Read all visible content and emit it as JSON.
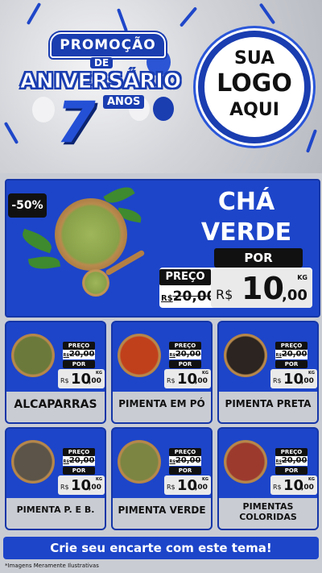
{
  "header": {
    "promo_top": "PROMOÇÃO",
    "promo_de": "DE",
    "promo_main": "ANIVERSÁRIO",
    "promo_number": "7",
    "promo_anos": "ANOS",
    "logo_line1": "SUA",
    "logo_line2": "LOGO",
    "logo_line3": "AQUI"
  },
  "featured": {
    "discount": "-50%",
    "title_line1": "CHÁ",
    "title_line2": "VERDE",
    "preco_label": "PREÇO",
    "por_label": "POR",
    "old_currency": "R$",
    "old_price": "20,00",
    "new_currency": "R$",
    "new_int": "10",
    "new_cents": ",00",
    "unit": "KG"
  },
  "products": [
    {
      "name": "ALCAPARRAS",
      "preco_label": "PREÇO",
      "por_label": "POR",
      "old_currency": "R$",
      "old_price": "20,00",
      "new_currency": "R$",
      "new_int": "10",
      "new_cents": ",00",
      "unit": "KG",
      "color": "#6b7a3a"
    },
    {
      "name": "PIMENTA EM PÓ",
      "preco_label": "PREÇO",
      "por_label": "POR",
      "old_currency": "R$",
      "old_price": "20,00",
      "new_currency": "R$",
      "new_int": "10",
      "new_cents": ",00",
      "unit": "KG",
      "color": "#c1401c"
    },
    {
      "name": "PIMENTA PRETA",
      "preco_label": "PREÇO",
      "por_label": "POR",
      "old_currency": "R$",
      "old_price": "20,00",
      "new_currency": "R$",
      "new_int": "10",
      "new_cents": ",00",
      "unit": "KG",
      "color": "#2b2420"
    },
    {
      "name": "PIMENTA P. E B.",
      "preco_label": "PREÇO",
      "por_label": "POR",
      "old_currency": "R$",
      "old_price": "20,00",
      "new_currency": "R$",
      "new_int": "10",
      "new_cents": ",00",
      "unit": "KG",
      "color": "#5c5448"
    },
    {
      "name": "PIMENTA VERDE",
      "preco_label": "PREÇO",
      "por_label": "POR",
      "old_currency": "R$",
      "old_price": "20,00",
      "new_currency": "R$",
      "new_int": "10",
      "new_cents": ",00",
      "unit": "KG",
      "color": "#7d8542"
    },
    {
      "name": "PIMENTAS COLORIDAS",
      "preco_label": "PREÇO",
      "por_label": "POR",
      "old_currency": "R$",
      "old_price": "20,00",
      "new_currency": "R$",
      "new_int": "10",
      "new_cents": ",00",
      "unit": "KG",
      "color": "#9c3a2e"
    }
  ],
  "footer": {
    "banner": "Crie seu encarte com este tema!",
    "disclaimer": "*Imagens Meramente Ilustrativas"
  },
  "colors": {
    "brand_blue": "#1d45c9",
    "dark": "#111111",
    "panel": "#c9ccd3"
  }
}
